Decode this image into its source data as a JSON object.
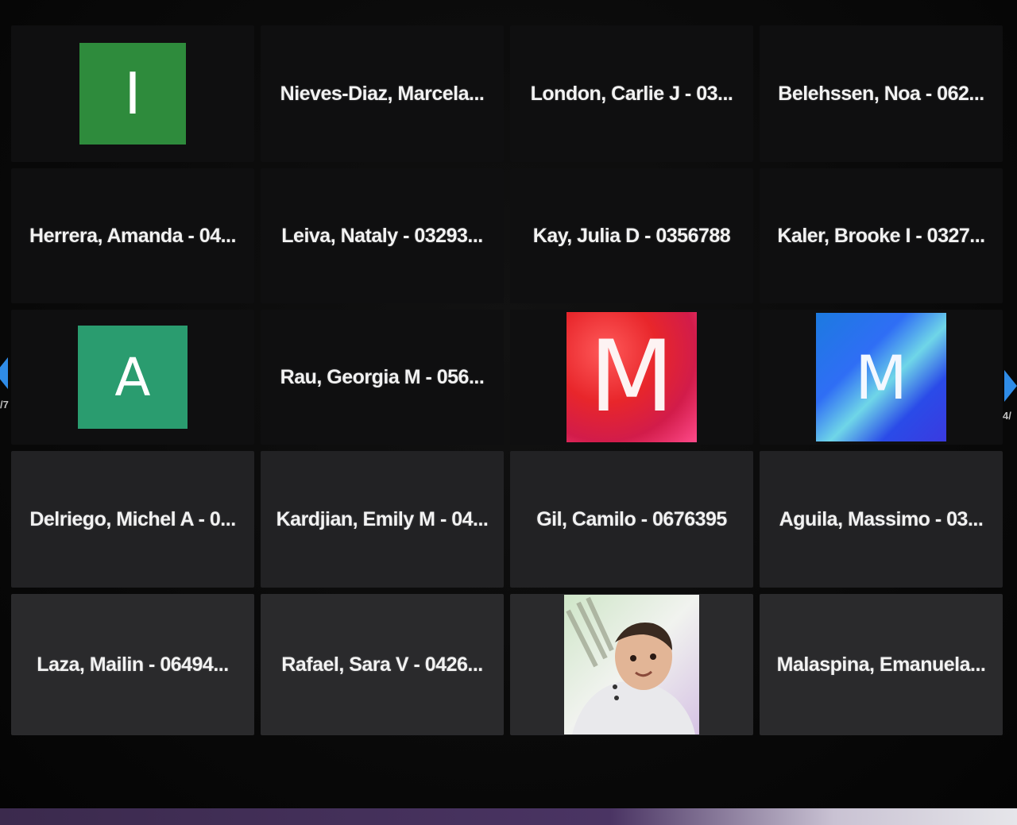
{
  "participants": [
    {
      "type": "avatar",
      "initial": "I"
    },
    {
      "type": "name",
      "label": "Nieves-Diaz, Marcela..."
    },
    {
      "type": "name",
      "label": "London, Carlie J - 03..."
    },
    {
      "type": "name",
      "label": "Belehssen, Noa - 062..."
    },
    {
      "type": "name",
      "label": "Herrera, Amanda - 04..."
    },
    {
      "type": "name",
      "label": "Leiva, Nataly - 03293..."
    },
    {
      "type": "name",
      "label": "Kay, Julia D - 0356788"
    },
    {
      "type": "name",
      "label": "Kaler, Brooke I - 0327..."
    },
    {
      "type": "avatar",
      "initial": "A"
    },
    {
      "type": "name",
      "label": "Rau, Georgia M - 056..."
    },
    {
      "type": "avatar",
      "initial": "M"
    },
    {
      "type": "avatar",
      "initial": "M"
    },
    {
      "type": "name",
      "label": "Delriego, Michel A - 0..."
    },
    {
      "type": "name",
      "label": "Kardjian, Emily M - 04..."
    },
    {
      "type": "name",
      "label": "Gil, Camilo - 0676395"
    },
    {
      "type": "name",
      "label": "Aguila, Massimo - 03..."
    },
    {
      "type": "name",
      "label": "Laza, Mailin - 06494..."
    },
    {
      "type": "name",
      "label": "Rafael, Sara V - 0426..."
    },
    {
      "type": "video"
    },
    {
      "type": "name",
      "label": "Malaspina, Emanuela..."
    }
  ],
  "pager": {
    "left_label": "/7",
    "right_label": "4/"
  },
  "colors": {
    "avatar_i": "#2e8b3c",
    "avatar_a": "#2a9c6f",
    "avatar_m_red": "#e8262b",
    "avatar_m_blue": "#2f6ef5",
    "nav_arrow": "#2f8ce8"
  }
}
